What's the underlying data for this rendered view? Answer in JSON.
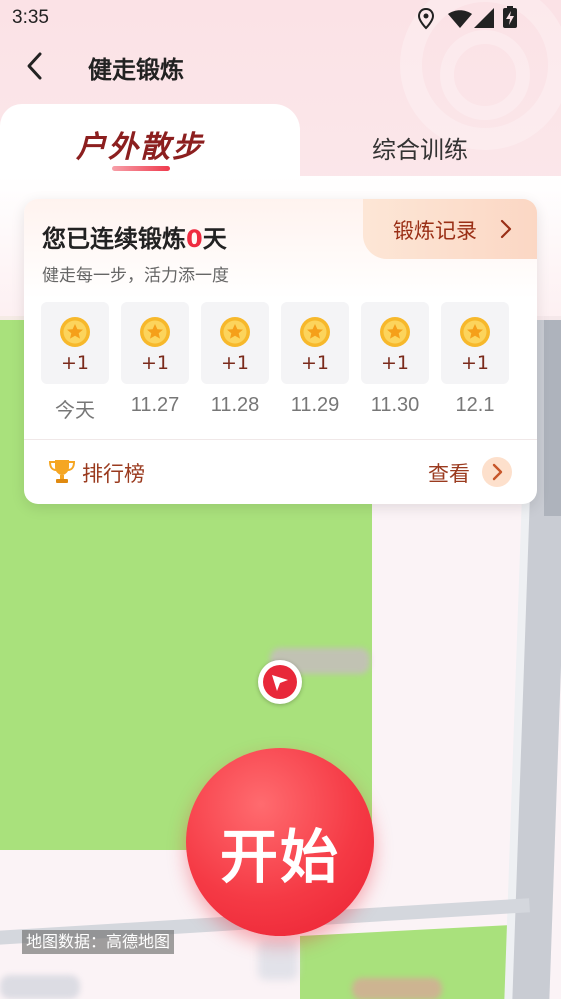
{
  "status_bar": {
    "time": "3:35"
  },
  "header": {
    "title": "健走锻炼"
  },
  "tabs": [
    {
      "label": "户外散步",
      "active": true
    },
    {
      "label": "综合训练",
      "active": false
    }
  ],
  "card": {
    "title_prefix": "您已连续锻炼",
    "streak_days": "0",
    "title_suffix": "天",
    "subtitle": "健走每一步，活力添一度",
    "record_button": "锻炼记录",
    "days": [
      {
        "reward": "+1",
        "label": "今天"
      },
      {
        "reward": "+1",
        "label": "11.27"
      },
      {
        "reward": "+1",
        "label": "11.28"
      },
      {
        "reward": "+1",
        "label": "11.29"
      },
      {
        "reward": "+1",
        "label": "11.30"
      },
      {
        "reward": "+1",
        "label": "12.1"
      }
    ],
    "leaderboard_label": "排行榜",
    "view_label": "查看"
  },
  "start_button": "开始",
  "map_credit": "地图数据：高德地图",
  "colors": {
    "accent": "#ef2b40",
    "brand_dark": "#8c1f1f",
    "map_green": "#a9e17c",
    "leaderboard_text": "#9a3a1e"
  }
}
